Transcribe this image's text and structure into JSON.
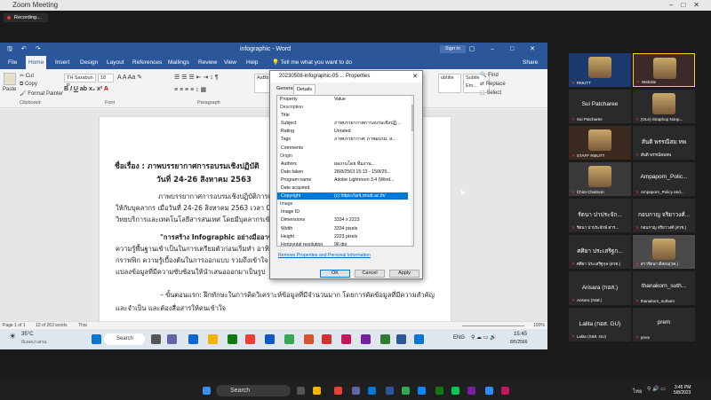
{
  "zoom": {
    "window_title": "Zoom Meeting",
    "recording_label": "Recording..."
  },
  "word": {
    "doc_title": "infographic - Word",
    "sign_in": "Sign in",
    "tabs": [
      "File",
      "Home",
      "Insert",
      "Design",
      "Layout",
      "References",
      "Mailings",
      "Review",
      "View",
      "Help"
    ],
    "tell_me": "Tell me what you want to do",
    "share": "Share",
    "ribbon": {
      "paste": "Paste",
      "cut": "Cut",
      "copy": "Copy",
      "format_painter": "Format Painter",
      "clipboard": "Clipboard",
      "font_name": "TH Sarabun P",
      "font_size": "18",
      "font": "Font",
      "paragraph": "Paragraph",
      "style1": "AaBb",
      "style2": "ubtitle",
      "style3": "Subtle Em...",
      "find": "Find",
      "replace": "Replace",
      "select": "Select"
    },
    "doc_lines": [
      "ชื่อเรื่อง : ภาพบรรยากาศการอบรมเชิงปฏิบัติ",
      "วันที่ 24-26 สิงหาคม 2563",
      "ภาพบรรยากาศการอบรมเชิงปฏิบัติการเชิ",
      "ให้กับบุคลากร เมื่อวันที่ 24-26 สิงหาคม 2563 เวลา 0",
      "วิทยบริการและเทคโนโลยีสารสนเทศ โดยมีบุคลากรเข้",
      "\"การสร้าง Infographic อย่างมืออาชีพ\" โ",
      "ความรู้พื้นฐานเข้าเป็นในการเตรียมตัวก่อนเริ่มทำ อาทิ",
      "กราฟฟิก ความรู้เบื้องต้นในการออกแบบ รวมถึงเข้าใจ",
      "แปลงข้อมูลที่มีความซับซ้อนให้นำเสนอออกมาเป็นรูป",
      "– ขั้นตอนแรก: ฝึกทักษะในการคิดวิเคราะห์ข้อมูลที่มีจำนวนมาก โดยการคัดข้อมูลที่มีความสำคัญ",
      "และจำเป็น และต้องสื่อสารให้คนเข้าใจ"
    ],
    "status": {
      "page": "Page 1 of 1",
      "words": "13 of 263 words",
      "lang": "Thai",
      "zoom": "100%"
    }
  },
  "taskbar_inner": {
    "weather_temp": "35°C",
    "weather_desc": "มีแดดบางส่วน",
    "search": "Search",
    "lang": "ENG",
    "time": "15:45",
    "date": "8/5/2566"
  },
  "dialog": {
    "title": "20230508-infographic-05 ... Properties",
    "tabs": [
      "General",
      "Details"
    ],
    "header": {
      "property": "Property",
      "value": "Value"
    },
    "rows": [
      {
        "type": "section",
        "k": "Description"
      },
      {
        "k": "Title",
        "v": ""
      },
      {
        "k": "Subject",
        "v": "ภาพบรรยากาศการอบรมเชิงปฏิ..."
      },
      {
        "k": "Rating",
        "v": "Unrated"
      },
      {
        "k": "Tags",
        "v": "ภาพบรรยากาศ; ภาพอบรม; ส..."
      },
      {
        "k": "Comments",
        "v": ""
      },
      {
        "type": "section",
        "k": "Origin"
      },
      {
        "k": "Authors",
        "v": "ผลงานโดย ทีมงาน..."
      },
      {
        "k": "Date taken",
        "v": "28/8/2563 15:13 - 15/8/25..."
      },
      {
        "k": "Program name",
        "v": "Adobe Lightroom 3.4 (Wind..."
      },
      {
        "k": "Date acquired",
        "v": ""
      },
      {
        "k": "Copyright",
        "v": "(c) https://arit.rmutt.ac.th/",
        "selected": true
      },
      {
        "type": "section",
        "k": "Image"
      },
      {
        "k": "Image ID",
        "v": ""
      },
      {
        "k": "Dimensions",
        "v": "3334 x 2223"
      },
      {
        "k": "Width",
        "v": "3334 pixels"
      },
      {
        "k": "Height",
        "v": "2223 pixels"
      },
      {
        "k": "Horizontal resolution",
        "v": "96 dpi"
      }
    ],
    "remove_link": "Remove Properties and Personal Information",
    "ok": "OK",
    "cancel": "Cancel",
    "apply": "Apply"
  },
  "participants": [
    {
      "name": "",
      "label": "RMUTT"
    },
    {
      "name": "",
      "label": "Website"
    },
    {
      "name": "Sui Patcharee",
      "label": "Sui Patcharee"
    },
    {
      "name": "",
      "label": "(OLe) Siraphop Nonp..."
    },
    {
      "name": "",
      "label": "STAFF RMUTT"
    },
    {
      "name": "สันติ พรรณีสม ทพ",
      "label": "สันติ พรรณีสมทพ"
    },
    {
      "name": "",
      "label": "Chira Chaitoon"
    },
    {
      "name": "Ampaporn_Polic...",
      "label": "Ampaporn_Policy and..."
    },
    {
      "name": "รัตนา ปาประจัก...",
      "label": "รัตนา ปาประจักษ์ สาร..."
    },
    {
      "name": "กอบกาญ จริยาวงศ์...",
      "label": "กอบกาญ จริยาวงศ์ (สวช.)"
    },
    {
      "name": "ศศิยา ประเสริฐก...",
      "label": "ศศิยา ประเสริฐกุล (สวช.)"
    },
    {
      "name": "",
      "label": "สาวรัตนา ดีสอน(วค.)"
    },
    {
      "name": "Arisara (กอส.)",
      "label": "Arisara (กอส.)"
    },
    {
      "name": "thanakorn_suth...",
      "label": "thanakorn_sutham"
    },
    {
      "name": "Lalita (กอส. GU)",
      "label": "Lalita (กอส. GU)"
    },
    {
      "name": "prem",
      "label": "prem"
    }
  ],
  "winbar": {
    "search": "Search",
    "lang": "ไทย",
    "time": "3:45 PM",
    "date": "5/8/2023"
  }
}
